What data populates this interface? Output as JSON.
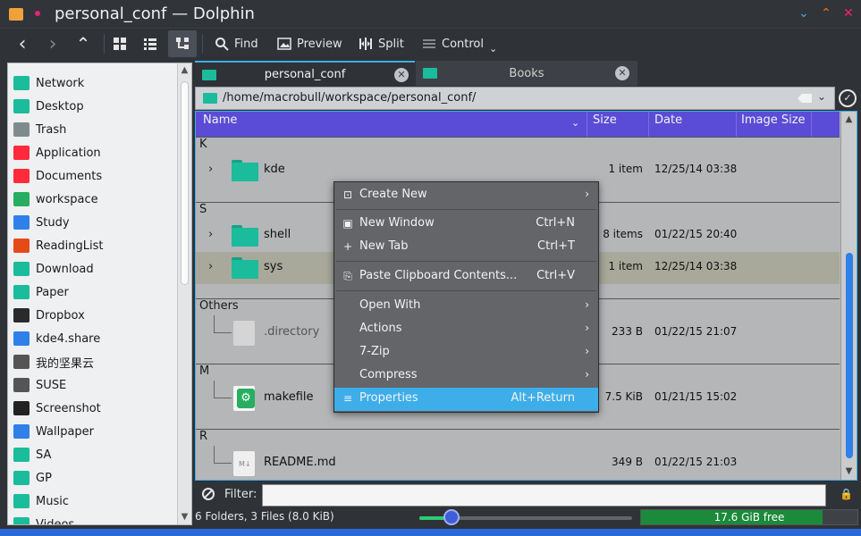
{
  "window": {
    "title": "personal_conf — Dolphin",
    "minimize_icon": "chevron-down-icon",
    "maximize_icon": "chevron-up-icon",
    "close_icon": "close-icon"
  },
  "toolbar": {
    "back_icon": "‹",
    "forward_icon": "›",
    "up_icon": "⌃",
    "find_label": "Find",
    "preview_label": "Preview",
    "split_label": "Split",
    "control_label": "Control"
  },
  "places": [
    {
      "label": "Network",
      "color": "#1abc9c",
      "icon": "network-icon"
    },
    {
      "label": "Desktop",
      "color": "#1abc9c",
      "icon": "desktop-icon"
    },
    {
      "label": "Trash",
      "color": "#7f8c8d",
      "icon": "trash-icon"
    },
    {
      "label": "Application",
      "color": "#ff2a3a",
      "icon": "application-icon"
    },
    {
      "label": "Documents",
      "color": "#ff2a3a",
      "icon": "documents-icon"
    },
    {
      "label": "workspace",
      "color": "#27ae60",
      "icon": "workspace-icon"
    },
    {
      "label": "Study",
      "color": "#2f80e8",
      "icon": "study-icon"
    },
    {
      "label": "ReadingList",
      "color": "#e64a19",
      "icon": "readinglist-icon"
    },
    {
      "label": "Download",
      "color": "#1abc9c",
      "icon": "download-icon"
    },
    {
      "label": "Paper",
      "color": "#1abc9c",
      "icon": "paper-icon"
    },
    {
      "label": "Dropbox",
      "color": "#2a2a2a",
      "icon": "dropbox-icon"
    },
    {
      "label": "kde4.share",
      "color": "#2f80e8",
      "icon": "kde-icon"
    },
    {
      "label": "我的坚果云",
      "color": "#555555",
      "icon": "cloud-icon"
    },
    {
      "label": "SUSE",
      "color": "#555555",
      "icon": "suse-icon"
    },
    {
      "label": "Screenshot",
      "color": "#222222",
      "icon": "screenshot-icon"
    },
    {
      "label": "Wallpaper",
      "color": "#2f80e8",
      "icon": "wallpaper-icon"
    },
    {
      "label": "SA",
      "color": "#1abc9c",
      "icon": "folder-icon"
    },
    {
      "label": "GP",
      "color": "#1abc9c",
      "icon": "folder-icon"
    },
    {
      "label": "Music",
      "color": "#1abc9c",
      "icon": "music-icon"
    },
    {
      "label": "Videos",
      "color": "#1abc9c",
      "icon": "videos-icon"
    }
  ],
  "tabs": [
    {
      "label": "personal_conf",
      "active": true
    },
    {
      "label": "Books",
      "active": false
    }
  ],
  "location": {
    "path": "/home/macrobull/workspace/personal_conf/"
  },
  "columns": {
    "name": "Name",
    "size": "Size",
    "date": "Date",
    "image_size": "Image Size"
  },
  "groups": [
    {
      "label": "K"
    },
    {
      "label": "S"
    },
    {
      "label": "Others"
    },
    {
      "label": "M"
    },
    {
      "label": "R"
    }
  ],
  "files": [
    {
      "name": "kde",
      "size": "1 item",
      "date": "12/25/14 03:38",
      "kind": "folder"
    },
    {
      "name": "shell",
      "size": "8 items",
      "date": "01/22/15 20:40",
      "kind": "folder"
    },
    {
      "name": "sys",
      "size": "1 item",
      "date": "12/25/14 03:38",
      "kind": "folder"
    },
    {
      "name": ".directory",
      "size": "233 B",
      "date": "01/22/15 21:07",
      "kind": "file"
    },
    {
      "name": "makefile",
      "size": "7.5 KiB",
      "date": "01/21/15 15:02",
      "kind": "makefile"
    },
    {
      "name": "README.md",
      "size": "349 B",
      "date": "01/22/15 21:03",
      "kind": "markdown"
    }
  ],
  "context_menu": [
    {
      "label": "Create New",
      "shortcut": "",
      "submenu": true,
      "icon": "create-new-icon"
    },
    {
      "label": "New Window",
      "shortcut": "Ctrl+N",
      "submenu": false,
      "icon": "new-window-icon"
    },
    {
      "label": "New Tab",
      "shortcut": "Ctrl+T",
      "submenu": false,
      "icon": "new-tab-icon"
    },
    {
      "label": "Paste Clipboard Contents...",
      "shortcut": "Ctrl+V",
      "submenu": false,
      "icon": "paste-icon"
    },
    {
      "label": "Open With",
      "shortcut": "",
      "submenu": true,
      "icon": ""
    },
    {
      "label": "Actions",
      "shortcut": "",
      "submenu": true,
      "icon": ""
    },
    {
      "label": "7-Zip",
      "shortcut": "",
      "submenu": true,
      "icon": ""
    },
    {
      "label": "Compress",
      "shortcut": "",
      "submenu": true,
      "icon": ""
    },
    {
      "label": "Properties",
      "shortcut": "Alt+Return",
      "submenu": false,
      "icon": "properties-icon",
      "highlighted": true
    }
  ],
  "filter": {
    "label": "Filter:",
    "value": ""
  },
  "status": {
    "summary": "6 Folders, 3 Files (8.0 KiB)",
    "zoom_fraction": 0.15,
    "free_space_label": "17.6 GiB free",
    "used_fraction": 0.84
  },
  "colors": {
    "accent": "#3daee9",
    "header": "#5a4cd6",
    "folder": "#1abc9c",
    "selection": "#a8a99a"
  }
}
